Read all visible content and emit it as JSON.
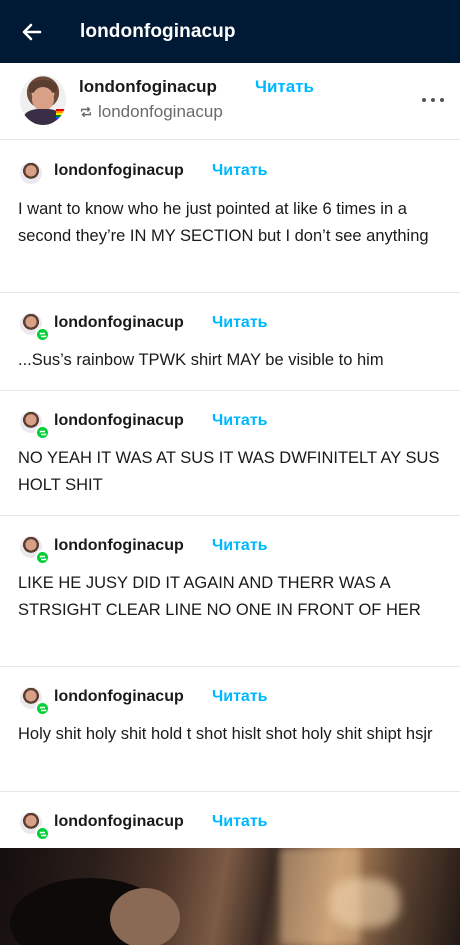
{
  "topbar": {
    "title": "londonfoginacup"
  },
  "post_header": {
    "blog_name": "londonfoginacup",
    "follow_label": "Читать",
    "reblogged_from": "londonfoginacup"
  },
  "entries": [
    {
      "name": "londonfoginacup",
      "follow": "Читать",
      "text": "I want to know who he just pointed at like 6 times in a second they’re IN MY SECTION but I don’t see anything"
    },
    {
      "name": "londonfoginacup",
      "follow": "Читать",
      "text": "...Sus’s rainbow TPWK shirt MAY be visible to him"
    },
    {
      "name": "londonfoginacup",
      "follow": "Читать",
      "text": "NO YEAH IT WAS AT SUS IT WAS DWFINITELT AY SUS HOLT SHIT"
    },
    {
      "name": "londonfoginacup",
      "follow": "Читать",
      "text": "LIKE HE JUSY DID IT AGAIN AND THERR WAS A STRSIGHT CLEAR LINE NO ONE IN FRONT OF HER"
    },
    {
      "name": "londonfoginacup",
      "follow": "Читать",
      "text": "Holy shit holy shit hold t shot hislt shot holy shit shipt hsjr"
    },
    {
      "name": "londonfoginacup",
      "follow": "Читать",
      "text": ""
    }
  ],
  "icons": {
    "back": "arrow-left-icon",
    "reblog": "reblog-icon",
    "more": "more-dots-icon",
    "badge": "reblog-badge-icon"
  },
  "colors": {
    "topbar_bg": "#001935",
    "follow_accent": "#00b8ff",
    "badge_green": "#00cf35"
  }
}
